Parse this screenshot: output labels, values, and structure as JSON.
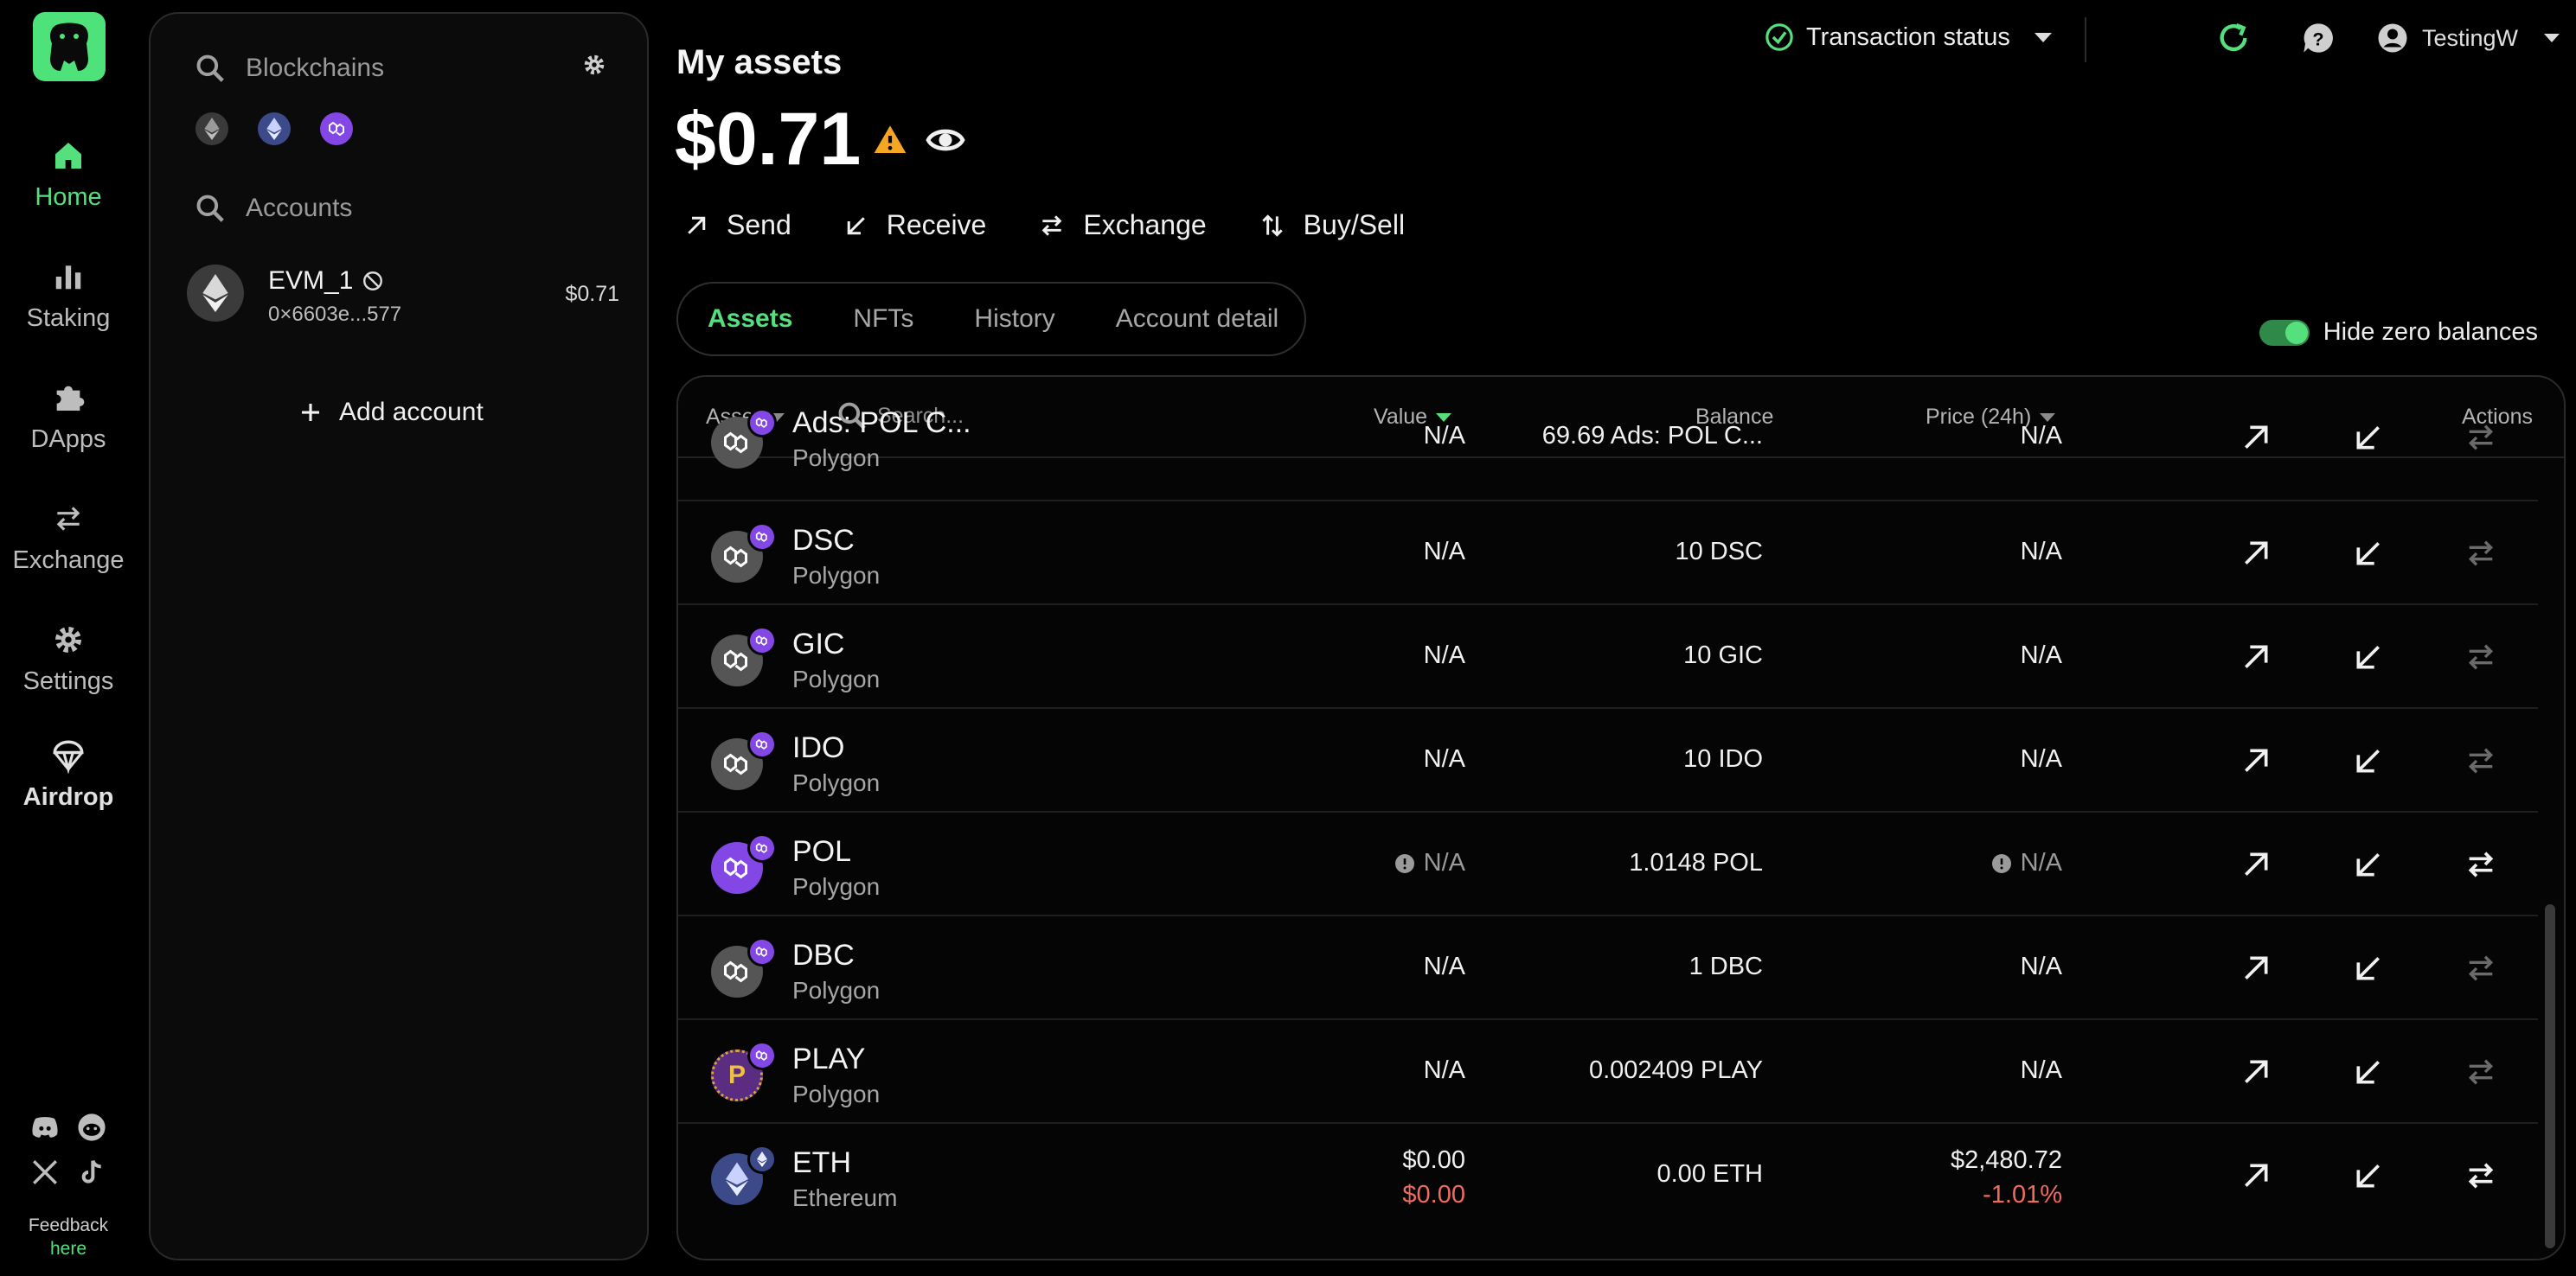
{
  "nav": {
    "items": [
      {
        "label": "Home",
        "icon": "home-icon"
      },
      {
        "label": "Staking",
        "icon": "bar-chart-icon"
      },
      {
        "label": "DApps",
        "icon": "puzzle-icon"
      },
      {
        "label": "Exchange",
        "icon": "swap-icon"
      },
      {
        "label": "Settings",
        "icon": "gear-icon"
      },
      {
        "label": "Airdrop",
        "icon": "parachute-icon"
      }
    ],
    "feedback_label": "Feedback",
    "feedback_link": "here"
  },
  "panel": {
    "blockchains_placeholder": "Blockchains",
    "accounts_placeholder": "Accounts",
    "account": {
      "name": "EVM_1",
      "address": "0×6603e...577",
      "balance": "$0.71"
    },
    "add_account_label": "Add account"
  },
  "header": {
    "title": "My assets",
    "total": "$0.71",
    "transaction_status_label": "Transaction status",
    "username": "TestingW"
  },
  "actions": {
    "send": "Send",
    "receive": "Receive",
    "exchange": "Exchange",
    "buysell": "Buy/Sell"
  },
  "tabs": {
    "assets": "Assets",
    "nfts": "NFTs",
    "history": "History",
    "account_detail": "Account detail"
  },
  "hide_zero_label": "Hide zero balances",
  "table": {
    "headers": {
      "asset": "Asset",
      "search_placeholder": "Search...",
      "value": "Value",
      "balance": "Balance",
      "price": "Price (24h)",
      "actions": "Actions"
    },
    "rows": [
      {
        "symbol": "Ads: POL C...",
        "network": "Polygon",
        "value": "N/A",
        "balance": "69.69 Ads: POL C...",
        "price": "N/A"
      },
      {
        "symbol": "DSC",
        "network": "Polygon",
        "value": "N/A",
        "balance": "10 DSC",
        "price": "N/A"
      },
      {
        "symbol": "GIC",
        "network": "Polygon",
        "value": "N/A",
        "balance": "10 GIC",
        "price": "N/A"
      },
      {
        "symbol": "IDO",
        "network": "Polygon",
        "value": "N/A",
        "balance": "10 IDO",
        "price": "N/A"
      },
      {
        "symbol": "POL",
        "network": "Polygon",
        "value": "N/A",
        "balance": "1.0148 POL",
        "price": "N/A"
      },
      {
        "symbol": "DBC",
        "network": "Polygon",
        "value": "N/A",
        "balance": "1 DBC",
        "price": "N/A"
      },
      {
        "symbol": "PLAY",
        "network": "Polygon",
        "value": "N/A",
        "balance": "0.002409 PLAY",
        "price": "N/A"
      },
      {
        "symbol": "ETH",
        "network": "Ethereum",
        "value": "$0.00",
        "value_change": "$0.00",
        "balance": "0.00 ETH",
        "price": "$2,480.72",
        "price_change": "-1.01%"
      }
    ]
  },
  "colors": {
    "accent": "#55e07d",
    "polygon": "#8247e5",
    "warning": "#f5a623",
    "negative": "#f06a5d"
  }
}
